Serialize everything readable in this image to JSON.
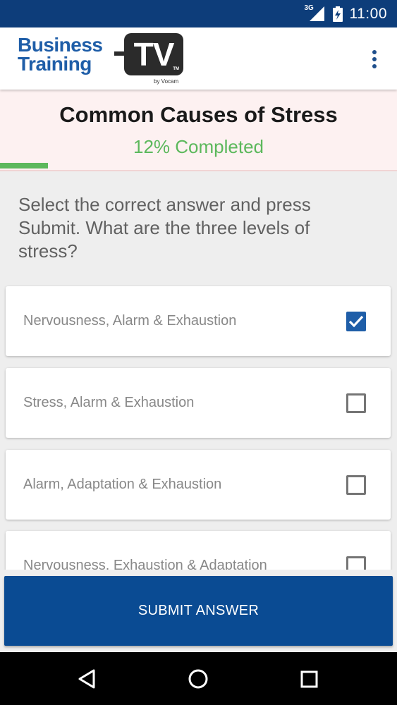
{
  "status_bar": {
    "network": "3G",
    "time": "11:00"
  },
  "app_bar": {
    "logo": {
      "line1": "Business",
      "line2": "Training",
      "tv": "TV",
      "tm": "TM",
      "tagline": "by Vocam"
    },
    "menu_icon": "overflow-menu-icon"
  },
  "course": {
    "title": "Common Causes of Stress",
    "progress_text": "12% Completed",
    "progress_fraction": 0.12
  },
  "question": {
    "text": "Select the correct answer and press Submit. What are the three levels of stress?"
  },
  "answers": [
    {
      "label": "Nervousness, Alarm & Exhaustion",
      "checked": true
    },
    {
      "label": "Stress, Alarm & Exhaustion",
      "checked": false
    },
    {
      "label": "Alarm, Adaptation & Exhaustion",
      "checked": false
    },
    {
      "label": "Nervousness, Exhaustion & Adaptation",
      "checked": false
    }
  ],
  "submit": {
    "label": "SUBMIT ANSWER"
  },
  "nav_bar": {
    "back_icon": "back-triangle-icon",
    "home_icon": "home-circle-icon",
    "recents_icon": "recents-square-icon"
  },
  "colors": {
    "brand_blue": "#0a4b93",
    "status_bar": "#0d3d7a",
    "progress_green": "#5cb85c",
    "header_bg": "#fdf1f1"
  }
}
